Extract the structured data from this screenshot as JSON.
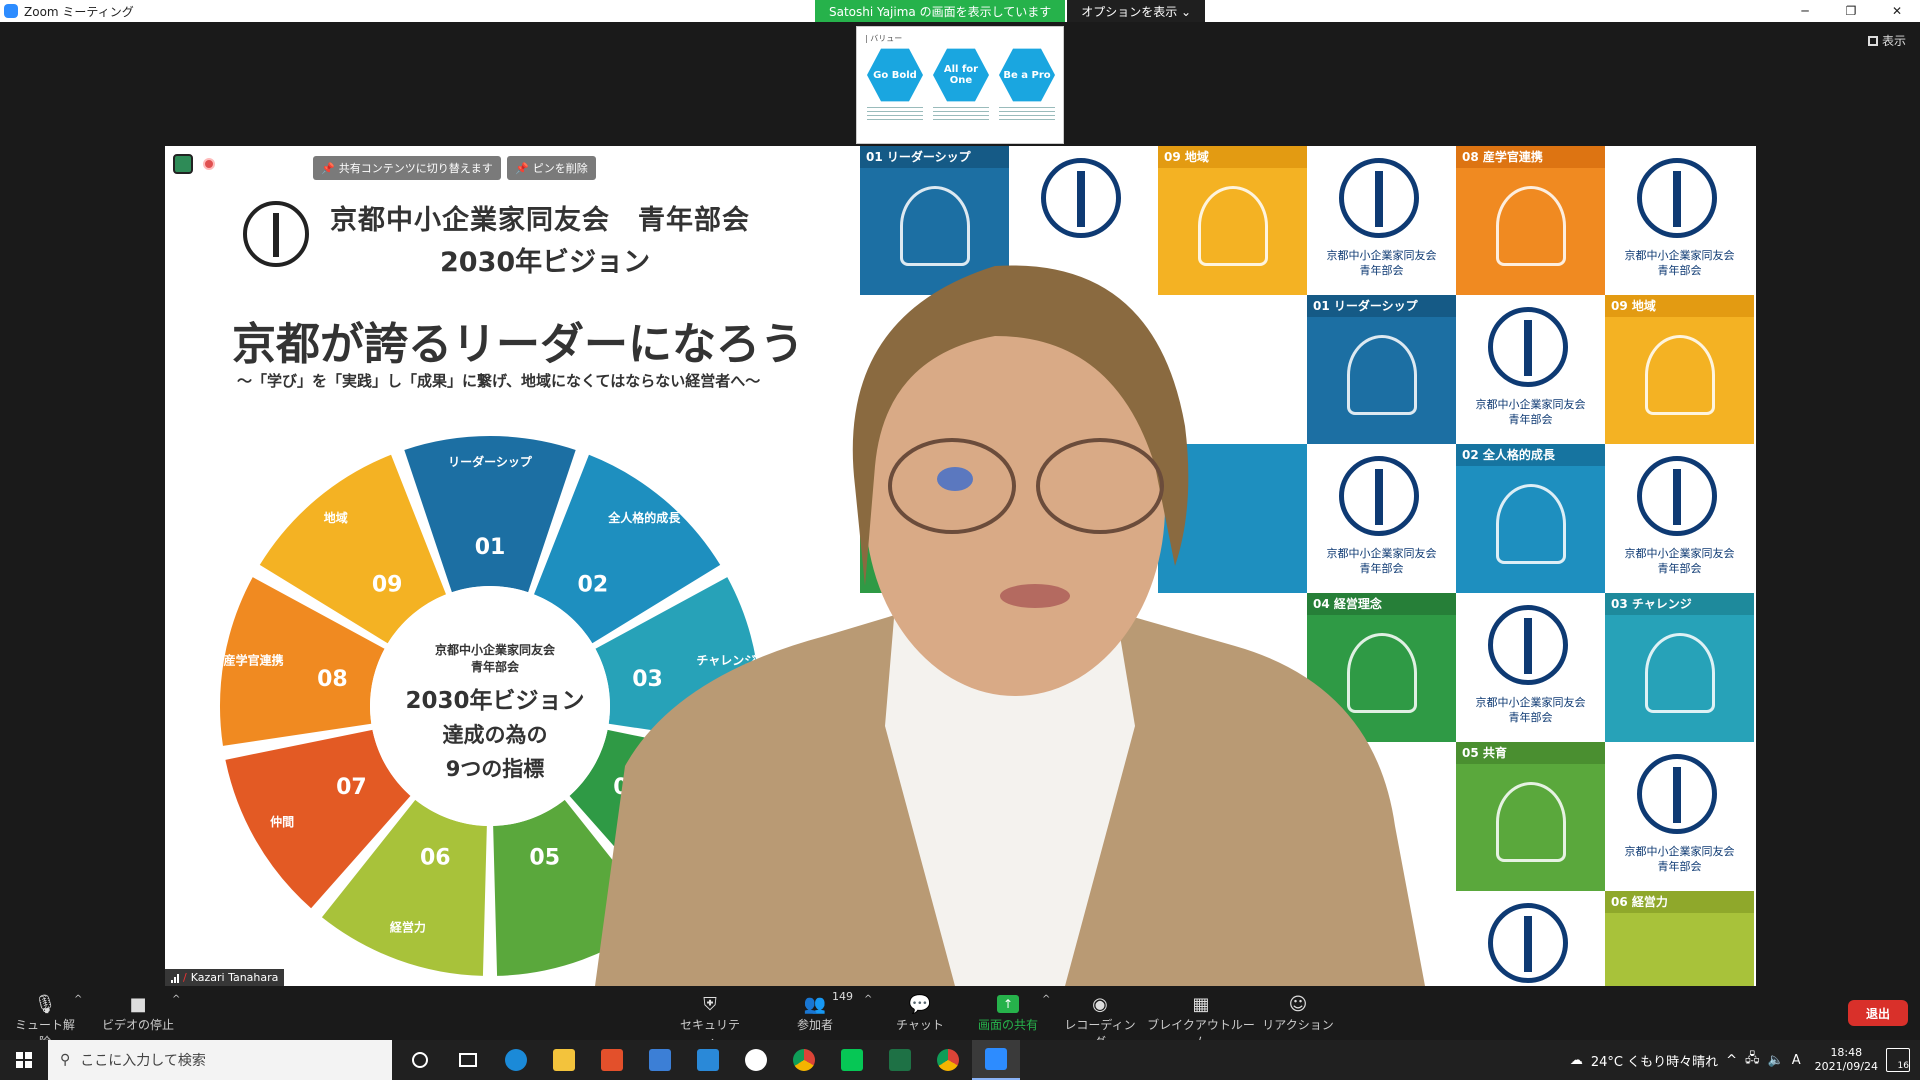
{
  "window": {
    "title": "Zoom ミーティング",
    "share_banner": "Satoshi Yajima の画面を表示しています",
    "options_label": "オプションを表示 ⌄",
    "view_label": "表示"
  },
  "thumbnail": {
    "label": "| バリュー",
    "values": [
      "Go Bold",
      "All for One",
      "Be a Pro"
    ]
  },
  "video": {
    "pin_switch_label": "共有コンテンツに切り替えます",
    "unpin_label": "ピンを削除",
    "participant_name": "Kazari Tanahara"
  },
  "slide": {
    "title_line1": "京都中小企業家同友会　青年部会",
    "title_line2": "2030年ビジョン",
    "headline": "京都が誇るリーダーになろう",
    "subline": "〜「学び」を「実践」し「成果」に繋げ、地域になくてはならない経営者へ〜",
    "center_org": "京都中小企業家同友会",
    "center_dept": "青年部会",
    "center_vision": "2030年ビジョン",
    "center_line1": "達成の為の",
    "center_line2": "9つの指標",
    "segments": [
      {
        "num": "01",
        "label": "リーダーシップ",
        "color": "#1c6fa3"
      },
      {
        "num": "02",
        "label": "全人格的成長",
        "color": "#1e8fbf"
      },
      {
        "num": "03",
        "label": "チャレンジ",
        "color": "#27a2b8"
      },
      {
        "num": "04",
        "label": "",
        "color": "#2f9a45"
      },
      {
        "num": "05",
        "label": "",
        "color": "#5aa83c"
      },
      {
        "num": "06",
        "label": "経営力",
        "color": "#a8c23a"
      },
      {
        "num": "07",
        "label": "仲間",
        "color": "#e35a24"
      },
      {
        "num": "08",
        "label": "産学官連携",
        "color": "#f08a21"
      },
      {
        "num": "09",
        "label": "地域",
        "color": "#f4b223"
      }
    ]
  },
  "tiles": {
    "logo_text_1": "京都中小企業家同友会",
    "logo_text_2": "青年部会",
    "t01": "01 リーダーシップ",
    "t09": "09 地域",
    "t08": "08 産学官連携",
    "t02": "02 全人格的成長",
    "t04": "04 経営理念",
    "t03": "03 チャレンジ",
    "t05": "05 共育",
    "t06": "06 経営力",
    "t0x": "04"
  },
  "toolbar": {
    "unmute": "ミュート解除",
    "stop_video": "ビデオの停止",
    "security": "セキュリティ",
    "participants": "参加者",
    "participant_count": "149",
    "chat": "チャット",
    "share": "画面の共有",
    "record": "レコーディング",
    "breakout": "ブレイクアウトルーム",
    "reactions": "リアクション",
    "leave": "退出"
  },
  "taskbar": {
    "search_placeholder": "ここに入力して検索",
    "weather": "24°C くもり時々晴れ",
    "ime": "A",
    "time": "18:48",
    "date": "2021/09/24",
    "notifications": "16"
  }
}
